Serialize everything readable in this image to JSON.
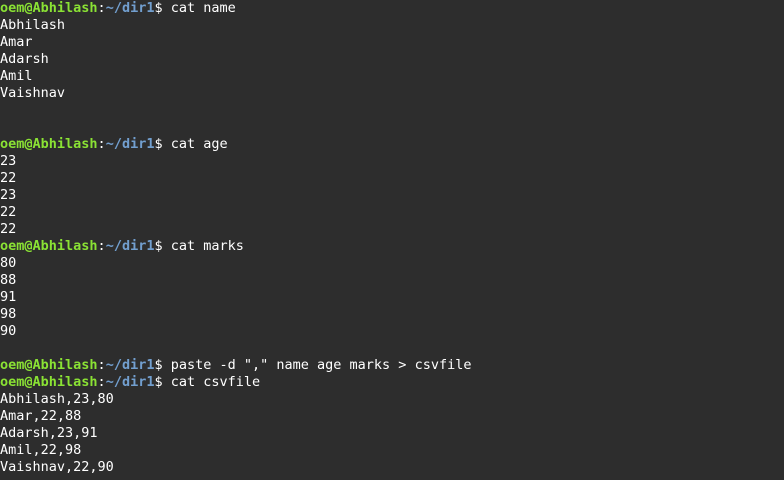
{
  "prompt": {
    "user_host": "oem@Abhilash",
    "separator": ":",
    "path": "~/dir1",
    "symbol": "$"
  },
  "colors": {
    "background": "#2d2d2d",
    "text": "#ffffff",
    "user_host": "#8ae234",
    "path": "#729fcf"
  },
  "lines": [
    {
      "type": "prompt",
      "command": " cat name"
    },
    {
      "type": "output",
      "text": "Abhilash"
    },
    {
      "type": "output",
      "text": "Amar"
    },
    {
      "type": "output",
      "text": "Adarsh"
    },
    {
      "type": "output",
      "text": "Amil"
    },
    {
      "type": "output",
      "text": "Vaishnav"
    },
    {
      "type": "output",
      "text": ""
    },
    {
      "type": "output",
      "text": ""
    },
    {
      "type": "prompt",
      "command": " cat age"
    },
    {
      "type": "output",
      "text": "23"
    },
    {
      "type": "output",
      "text": "22"
    },
    {
      "type": "output",
      "text": "23"
    },
    {
      "type": "output",
      "text": "22"
    },
    {
      "type": "output",
      "text": "22"
    },
    {
      "type": "prompt",
      "command": " cat marks"
    },
    {
      "type": "output",
      "text": "80"
    },
    {
      "type": "output",
      "text": "88"
    },
    {
      "type": "output",
      "text": "91"
    },
    {
      "type": "output",
      "text": "98"
    },
    {
      "type": "output",
      "text": "90"
    },
    {
      "type": "output",
      "text": ""
    },
    {
      "type": "prompt",
      "command": " paste -d \",\" name age marks > csvfile"
    },
    {
      "type": "prompt",
      "command": " cat csvfile"
    },
    {
      "type": "output",
      "text": "Abhilash,23,80"
    },
    {
      "type": "output",
      "text": "Amar,22,88"
    },
    {
      "type": "output",
      "text": "Adarsh,23,91"
    },
    {
      "type": "output",
      "text": "Amil,22,98"
    },
    {
      "type": "output",
      "text": "Vaishnav,22,90"
    }
  ]
}
